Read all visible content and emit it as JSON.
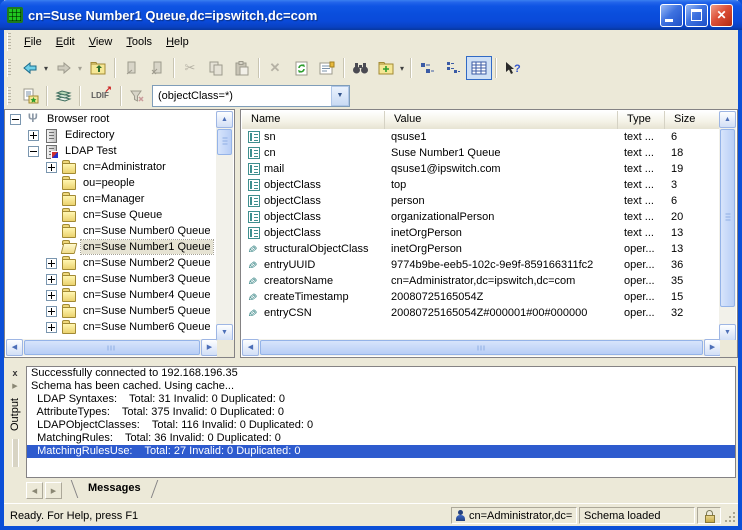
{
  "window": {
    "title": "cn=Suse Number1 Queue,dc=ipswitch,dc=com"
  },
  "menu": {
    "items": [
      "File",
      "Edit",
      "View",
      "Tools",
      "Help"
    ]
  },
  "toolbar": {
    "ldif_label": "LDIF",
    "filter_value": "(objectClass=*)"
  },
  "tree": {
    "items": [
      {
        "label": "Browser root",
        "level": 0,
        "expander": "minus",
        "icon": "root"
      },
      {
        "label": "Edirectory",
        "level": 1,
        "expander": "plus",
        "icon": "server"
      },
      {
        "label": "LDAP Test",
        "level": 1,
        "expander": "minus",
        "icon": "server-x"
      },
      {
        "label": "cn=Administrator",
        "level": 2,
        "expander": "plus",
        "icon": "folder"
      },
      {
        "label": "ou=people",
        "level": 2,
        "expander": "none",
        "icon": "folder"
      },
      {
        "label": "cn=Manager",
        "level": 2,
        "expander": "none",
        "icon": "folder"
      },
      {
        "label": "cn=Suse Queue",
        "level": 2,
        "expander": "none",
        "icon": "folder"
      },
      {
        "label": "cn=Suse Number0 Queue",
        "level": 2,
        "expander": "none",
        "icon": "folder"
      },
      {
        "label": "cn=Suse Number1 Queue",
        "level": 2,
        "expander": "none",
        "icon": "folder-open",
        "selected": true
      },
      {
        "label": "cn=Suse Number2 Queue",
        "level": 2,
        "expander": "plus",
        "icon": "folder"
      },
      {
        "label": "cn=Suse Number3 Queue",
        "level": 2,
        "expander": "plus",
        "icon": "folder"
      },
      {
        "label": "cn=Suse Number4 Queue",
        "level": 2,
        "expander": "plus",
        "icon": "folder"
      },
      {
        "label": "cn=Suse Number5 Queue",
        "level": 2,
        "expander": "plus",
        "icon": "folder"
      },
      {
        "label": "cn=Suse Number6 Queue",
        "level": 2,
        "expander": "plus",
        "icon": "folder"
      }
    ]
  },
  "attributes": {
    "columns": [
      "Name",
      "Value",
      "Type",
      "Size"
    ],
    "rows": [
      {
        "name": "sn",
        "value": "qsuse1",
        "type": "text ...",
        "size": "6",
        "icon": "text"
      },
      {
        "name": "cn",
        "value": "Suse Number1 Queue",
        "type": "text ...",
        "size": "18",
        "icon": "text"
      },
      {
        "name": "mail",
        "value": "qsuse1@ipswitch.com",
        "type": "text ...",
        "size": "19",
        "icon": "text"
      },
      {
        "name": "objectClass",
        "value": "top",
        "type": "text ...",
        "size": "3",
        "icon": "text"
      },
      {
        "name": "objectClass",
        "value": "person",
        "type": "text ...",
        "size": "6",
        "icon": "text"
      },
      {
        "name": "objectClass",
        "value": "organizationalPerson",
        "type": "text ...",
        "size": "20",
        "icon": "text"
      },
      {
        "name": "objectClass",
        "value": "inetOrgPerson",
        "type": "text ...",
        "size": "13",
        "icon": "text"
      },
      {
        "name": "structuralObjectClass",
        "value": "inetOrgPerson",
        "type": "oper...",
        "size": "13",
        "icon": "operational"
      },
      {
        "name": "entryUUID",
        "value": "9774b9be-eeb5-102c-9e9f-859166311fc2",
        "type": "oper...",
        "size": "36",
        "icon": "operational"
      },
      {
        "name": "creatorsName",
        "value": "cn=Administrator,dc=ipswitch,dc=com",
        "type": "oper...",
        "size": "35",
        "icon": "operational"
      },
      {
        "name": "createTimestamp",
        "value": "20080725165054Z",
        "type": "oper...",
        "size": "15",
        "icon": "operational"
      },
      {
        "name": "entryCSN",
        "value": "20080725165054Z#000001#00#000000",
        "type": "oper...",
        "size": "32",
        "icon": "operational"
      }
    ]
  },
  "output": {
    "label": "Output",
    "tab": "Messages",
    "lines": [
      {
        "text": "Successfully connected to 192.168.196.35"
      },
      {
        "text": "Schema has been cached. Using cache..."
      },
      {
        "text": "  LDAP Syntaxes:    Total: 31 Invalid: 0 Duplicated: 0"
      },
      {
        "text": "  AttributeTypes:    Total: 375 Invalid: 0 Duplicated: 0"
      },
      {
        "text": "  LDAPObjectClasses:    Total: 116 Invalid: 0 Duplicated: 0"
      },
      {
        "text": "  MatchingRules:    Total: 36 Invalid: 0 Duplicated: 0"
      },
      {
        "text": "  MatchingRulesUse:    Total: 27 Invalid: 0 Duplicated: 0",
        "selected": true
      }
    ]
  },
  "statusbar": {
    "message": "Ready. For Help, press F1",
    "user": "cn=Administrator,dc=",
    "schema": "Schema loaded"
  },
  "colors": {
    "titlebar_blue": "#0A4ADA",
    "face": "#ECE9D8",
    "selection_blue": "#2E5BCE",
    "folder_yellow": "#EFD87B"
  }
}
